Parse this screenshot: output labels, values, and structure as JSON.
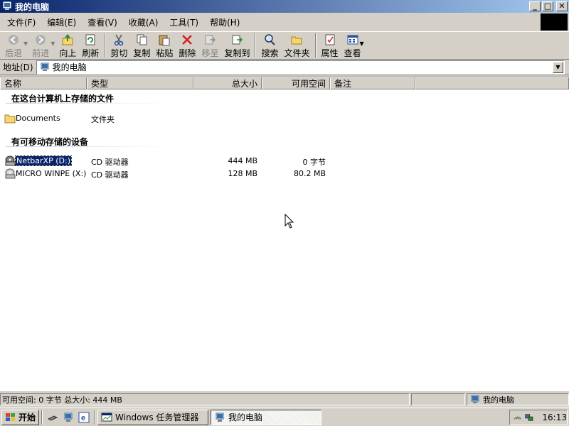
{
  "window": {
    "title": "我的电脑",
    "buttons": {
      "minimize": "_",
      "maximize": "□",
      "close": "✕"
    }
  },
  "menu": [
    "文件(F)",
    "编辑(E)",
    "查看(V)",
    "收藏(A)",
    "工具(T)",
    "帮助(H)"
  ],
  "toolbar": {
    "back": "后退",
    "forward": "前进",
    "up": "向上",
    "refresh": "刷新",
    "cut": "剪切",
    "copy": "复制",
    "paste": "粘贴",
    "delete": "删除",
    "move_to": "移至",
    "copy_to": "复制到",
    "search": "搜索",
    "folders": "文件夹",
    "properties": "属性",
    "view": "查看"
  },
  "address": {
    "label": "地址(D)",
    "value": "我的电脑"
  },
  "columns": [
    "名称",
    "类型",
    "总大小",
    "可用空间",
    "备注"
  ],
  "groups": [
    {
      "title": "在这台计算机上存储的文件",
      "items": [
        {
          "name": "Documents",
          "type": "文件夹",
          "total": "",
          "free": "",
          "icon": "folder-icon"
        }
      ]
    },
    {
      "title": "有可移动存储的设备",
      "items": [
        {
          "name": "NetbarXP (D:)",
          "type": "CD 驱动器",
          "total": "444 MB",
          "free": "0 字节",
          "icon": "cd-drive-icon",
          "selected": true
        },
        {
          "name": "MICRO WINPE (X:)",
          "type": "CD 驱动器",
          "total": "128 MB",
          "free": "80.2 MB",
          "icon": "cd-drive-icon"
        }
      ]
    }
  ],
  "status": {
    "info": "可用空间: 0 字节 总大小: 444 MB",
    "location": "我的电脑"
  },
  "taskbar": {
    "start": "开始",
    "tasks": [
      {
        "label": "Windows 任务管理器",
        "active": false
      },
      {
        "label": "我的电脑",
        "active": true
      }
    ],
    "clock": "16:13"
  },
  "colors": {
    "title_gradient_start": "#0a246a",
    "title_gradient_end": "#a6caf0",
    "face": "#d4d0c8",
    "selection": "#0a246a"
  }
}
